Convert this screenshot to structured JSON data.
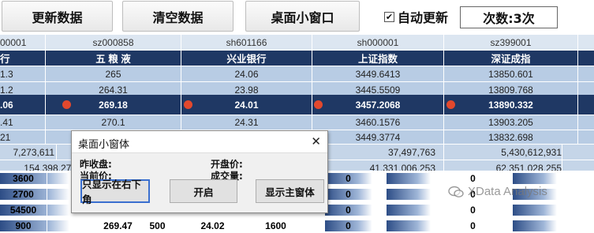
{
  "toolbar": {
    "update_label": "更新数据",
    "clear_label": "清空数据",
    "mini_label": "桌面小窗口",
    "auto_update_label": "自动更新",
    "auto_update_checked": "✔",
    "count_label": "次数:3次"
  },
  "columns": {
    "codes": [
      "00001",
      "sz000858",
      "sh601166",
      "sh000001",
      "sz399001"
    ],
    "names": [
      "行",
      "五 粮 液",
      "兴业银行",
      "上证指数",
      "深证成指"
    ]
  },
  "rows": [
    [
      "1.3",
      "265",
      "24.06",
      "3449.6413",
      "13850.601"
    ],
    [
      "1.2",
      "264.31",
      "23.98",
      "3445.5509",
      "13809.768"
    ],
    [
      ".06",
      "269.18",
      "24.01",
      "3457.2068",
      "13890.332"
    ],
    [
      ".41",
      "270.1",
      "24.31",
      "3460.1576",
      "13903.205"
    ],
    [
      "21",
      "",
      "",
      "3449.3774",
      "13832.698"
    ]
  ],
  "totals": {
    "row1": [
      "7,273,611",
      "37,497,763",
      "5,430,612,931"
    ],
    "row2": [
      "154,398,278",
      "41,331,006,253",
      "62,351,028,255"
    ]
  },
  "bar_rows": {
    "col0": [
      "3600",
      "2700",
      "54500",
      "900"
    ],
    "col_right": [
      "0",
      "0",
      "0",
      "0"
    ],
    "partial": [
      "269.47",
      "500",
      "24.02",
      "1600"
    ]
  },
  "dialog": {
    "title": "桌面小窗体",
    "close": "✕",
    "prev_close_label": "昨收盘:",
    "current_label": "当前价:",
    "open_label": "开盘价:",
    "volume_label": "成交量:",
    "btn_bottom_right": "只显示在右下角",
    "btn_start": "开启",
    "btn_show_main": "显示主窗体"
  },
  "watermark": {
    "text": "XData Analysis"
  },
  "colors": {
    "header_dark": "#1f3864",
    "row_light": "#b8cce4",
    "dot": "#e2482d"
  }
}
